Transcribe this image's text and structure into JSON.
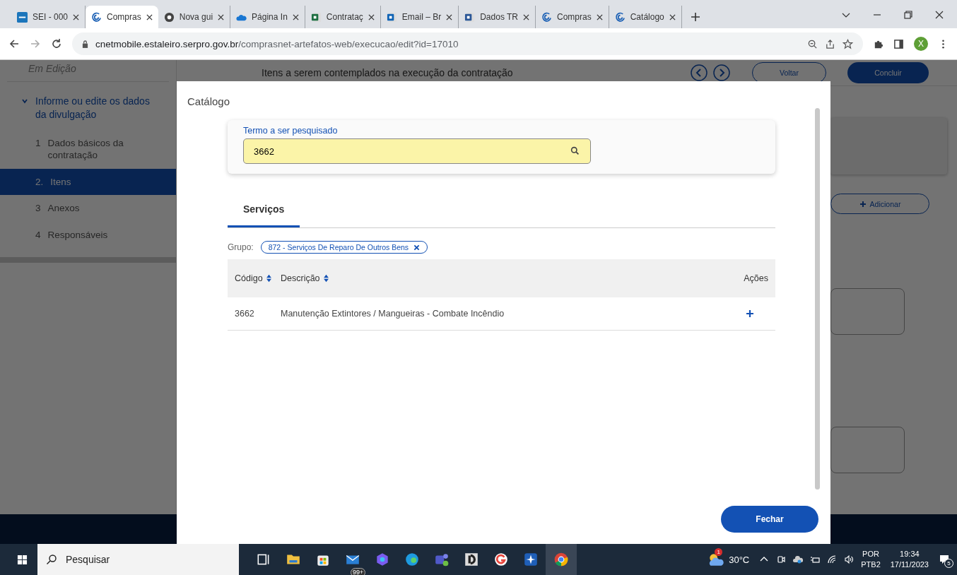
{
  "browser": {
    "tabs": [
      {
        "kind": "sei",
        "title": "SEI - 000",
        "selected": false
      },
      {
        "kind": "compras",
        "title": "Compras",
        "selected": true
      },
      {
        "kind": "chrome",
        "title": "Nova gui",
        "selected": false
      },
      {
        "kind": "onedrive",
        "title": "Página In",
        "selected": false
      },
      {
        "kind": "excel",
        "title": "Contrataç",
        "selected": false
      },
      {
        "kind": "outlook",
        "title": "Email – Br",
        "selected": false
      },
      {
        "kind": "word",
        "title": "Dados TR",
        "selected": false
      },
      {
        "kind": "compras",
        "title": "Compras",
        "selected": false
      },
      {
        "kind": "compras",
        "title": "Catálogo",
        "selected": false
      }
    ],
    "address": {
      "host": "cnetmobile.estaleiro.serpro.gov.br",
      "path": "/comprasnet-artefatos-web/execucao/edit?id=17010"
    },
    "profile_initial": "X"
  },
  "page": {
    "status": "Em Edição",
    "section_title": "Itens a serem contemplados na execução da contratação",
    "buttons": {
      "back": "Voltar",
      "finish": "Concluir",
      "add": "Adicionar"
    },
    "sidebar": {
      "group": "Informe ou edite os dados da divulgação",
      "expanded": true,
      "items": [
        {
          "number": "1",
          "label": "Dados básicos da contratação",
          "selected": false
        },
        {
          "number": "2.",
          "label": "Itens",
          "selected": true
        },
        {
          "number": "3",
          "label": "Anexos",
          "selected": false
        },
        {
          "number": "4",
          "label": "Responsáveis",
          "selected": false
        }
      ]
    }
  },
  "modal": {
    "title": "Catálogo",
    "search": {
      "label": "Termo a ser pesquisado",
      "value": "3662"
    },
    "tabs": [
      {
        "label": "Serviços",
        "selected": true
      }
    ],
    "filter": {
      "label": "Grupo:",
      "chip": "872 - Serviços De Reparo De Outros Bens"
    },
    "table": {
      "columns": [
        {
          "label": "Código",
          "sortable": true
        },
        {
          "label": "Descrição",
          "sortable": true
        },
        {
          "label": "Ações",
          "sortable": false
        }
      ],
      "rows": [
        {
          "code": "3662",
          "description": "Manutenção Extintores / Mangueiras - Combate Incêndio"
        }
      ]
    },
    "close_button": "Fechar"
  },
  "taskbar": {
    "search_placeholder": "Pesquisar",
    "mail_badge": "99+",
    "weather": {
      "temperature": "30°C",
      "badge": "1"
    },
    "language": "POR",
    "layout": "PTB2",
    "time": "19:34",
    "date": "17/11/2023",
    "notifications": "5"
  }
}
